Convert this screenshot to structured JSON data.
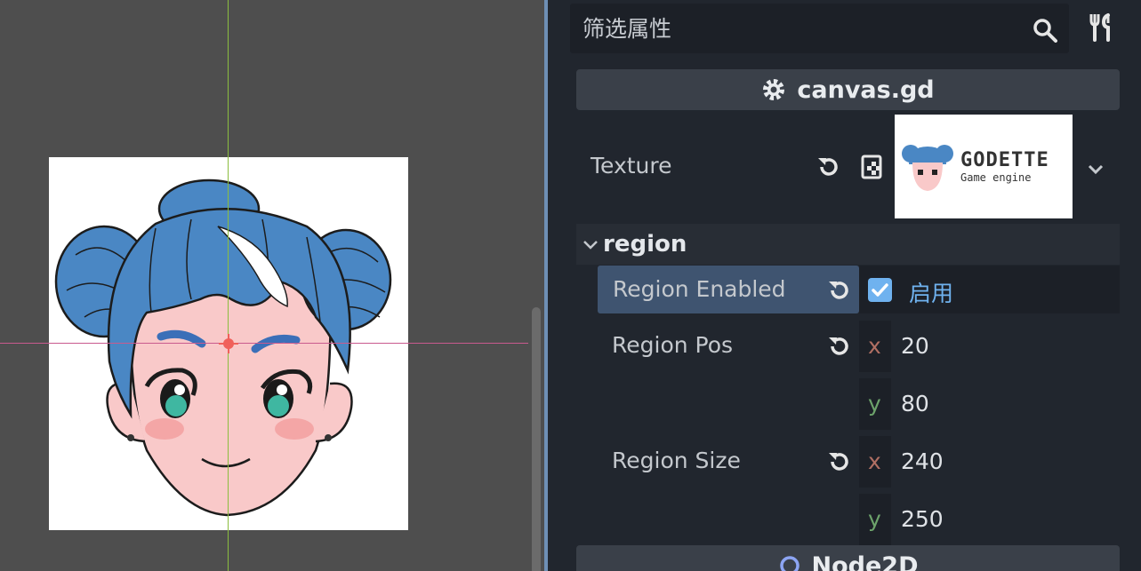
{
  "inspector": {
    "filter_placeholder": "筛选属性",
    "script_title": "canvas.gd",
    "texture_label": "Texture",
    "texture_thumb": {
      "logo_text": "GODETTE",
      "logo_subtitle": "Game engine"
    },
    "region_section": "region",
    "region_enabled_label": "Region Enabled",
    "region_enabled_value": "启用",
    "region_enabled_checked": true,
    "region_pos_label": "Region Pos",
    "region_pos": {
      "x_label": "x",
      "x": "20",
      "y_label": "y",
      "y": "80"
    },
    "region_size_label": "Region Size",
    "region_size": {
      "x_label": "x",
      "x": "240",
      "y_label": "y",
      "y": "250"
    },
    "next_section": "Node2D"
  },
  "colors": {
    "accent": "#6fb2ef",
    "axis_x": "#b06f63",
    "axis_y": "#6da36b",
    "guide_vertical": "#8bbd3f",
    "guide_horizontal": "#c95a8e"
  }
}
